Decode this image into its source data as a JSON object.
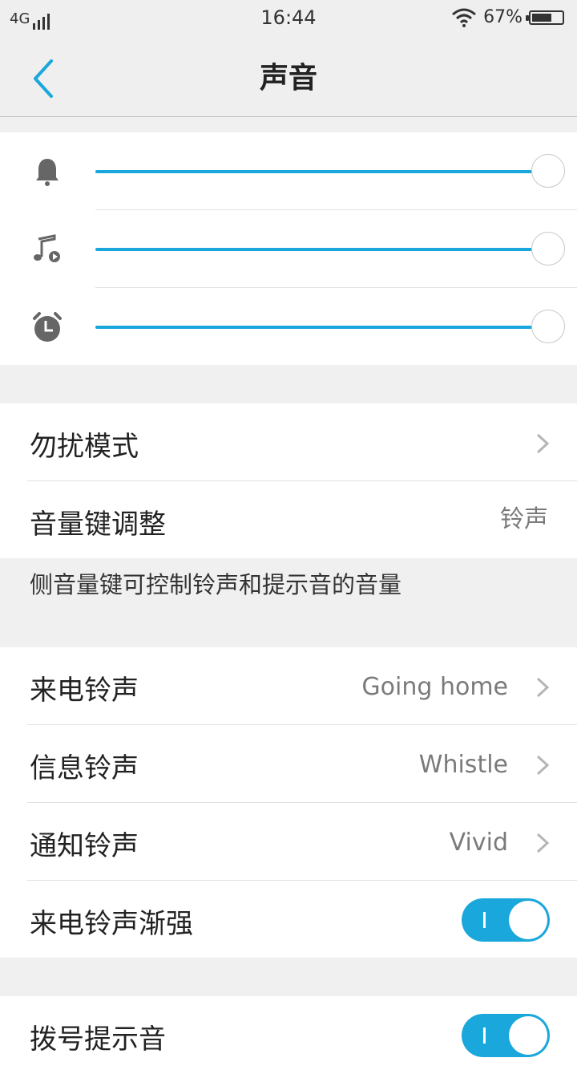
{
  "status_bar": {
    "network": "4G",
    "time": "16:44",
    "battery": "67%"
  },
  "nav": {
    "title": "声音"
  },
  "volume": {
    "items": [
      {
        "icon": "bell-icon",
        "level": 1.0
      },
      {
        "icon": "music-icon",
        "level": 1.0
      },
      {
        "icon": "alarm-icon",
        "level": 1.0
      }
    ]
  },
  "settings": {
    "dnd_label": "勿扰模式",
    "volume_key_label": "音量键调整",
    "volume_key_value": "铃声",
    "hint": "侧音量键可控制铃声和提示音的音量"
  },
  "ringtones": {
    "incoming_label": "来电铃声",
    "incoming_value": "Going home",
    "message_label": "信息铃声",
    "message_value": "Whistle",
    "notification_label": "通知铃声",
    "notification_value": "Vivid",
    "crescendo_label": "来电铃声渐强",
    "crescendo_on": true
  },
  "more": {
    "dial_tone_label": "拨号提示音",
    "dial_tone_on": true
  },
  "colors": {
    "accent": "#1aa7db",
    "background": "#f0f0f0"
  }
}
